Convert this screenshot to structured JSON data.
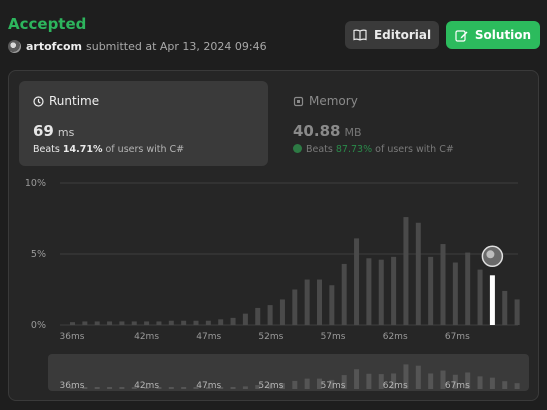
{
  "header": {
    "status": "Accepted",
    "username": "artofcom",
    "submitted_text": "submitted at Apr 13, 2024 09:46",
    "editorial_label": "Editorial",
    "solution_label": "Solution"
  },
  "runtime": {
    "title": "Runtime",
    "value": "69",
    "unit": "ms",
    "beats_prefix": "Beats",
    "beats_pct": "14.71%",
    "beats_suffix": "of users with C#"
  },
  "memory": {
    "title": "Memory",
    "value": "40.88",
    "unit": "MB",
    "beats_prefix": "Beats",
    "beats_pct": "87.73%",
    "beats_suffix": "of users with C#"
  },
  "colors": {
    "accepted": "#2db55d",
    "solution_button": "#2cbb5d",
    "bar": "#4a4a4a",
    "bar_highlight": "#ffffff"
  },
  "chart_data": {
    "type": "bar",
    "ylim": [
      0,
      10
    ],
    "y_ticks": [
      "0%",
      "5%",
      "10%"
    ],
    "x_tick_labels": [
      "36ms",
      "42ms",
      "47ms",
      "52ms",
      "57ms",
      "62ms",
      "67ms"
    ],
    "x_tick_values": [
      36,
      42,
      47,
      52,
      57,
      62,
      67
    ],
    "x": [
      36,
      37,
      38,
      39,
      40,
      41,
      42,
      43,
      44,
      45,
      46,
      47,
      48,
      49,
      50,
      51,
      52,
      53,
      54,
      55,
      56,
      57,
      58,
      59,
      60,
      61,
      62,
      63,
      64,
      65,
      66,
      67,
      68,
      69,
      70
    ],
    "values": [
      0.2,
      0.25,
      0.25,
      0.25,
      0.25,
      0.25,
      0.25,
      0.25,
      0.3,
      0.3,
      0.3,
      0.3,
      0.4,
      0.5,
      0.8,
      1.2,
      1.4,
      1.8,
      2.5,
      3.2,
      3.2,
      2.8,
      4.3,
      6.1,
      4.7,
      4.6,
      4.8,
      7.6,
      7.2,
      4.8,
      5.7,
      4.4,
      5.1,
      3.9,
      3.5,
      2.4,
      1.8
    ],
    "your_value_index": 34,
    "your_value": 3.5
  }
}
